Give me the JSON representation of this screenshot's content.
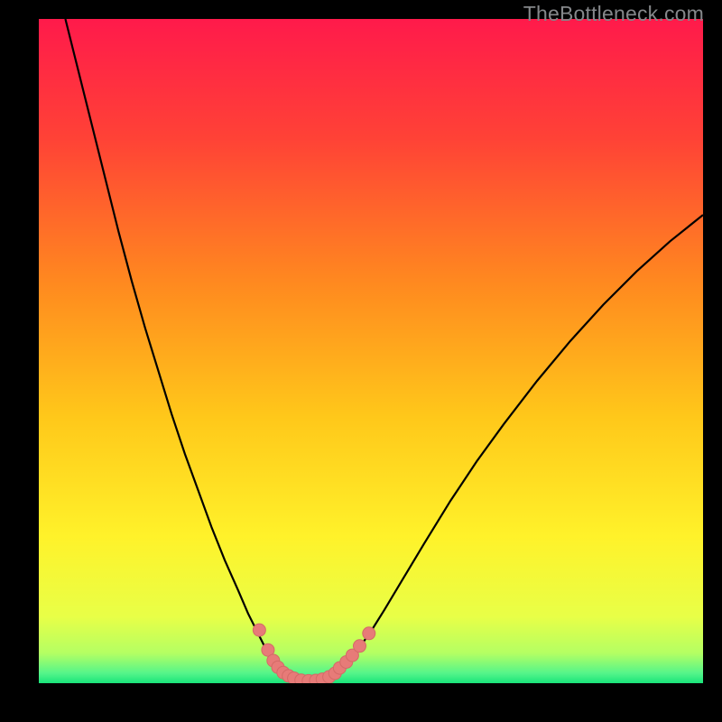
{
  "watermark": "TheBottleneck.com",
  "colors": {
    "gradient_stops": [
      {
        "offset": 0.0,
        "color": "#ff1a4b"
      },
      {
        "offset": 0.18,
        "color": "#ff4236"
      },
      {
        "offset": 0.4,
        "color": "#ff8a1f"
      },
      {
        "offset": 0.6,
        "color": "#ffc81a"
      },
      {
        "offset": 0.78,
        "color": "#fff22a"
      },
      {
        "offset": 0.9,
        "color": "#e8ff47"
      },
      {
        "offset": 0.955,
        "color": "#b4ff63"
      },
      {
        "offset": 0.985,
        "color": "#55f58a"
      },
      {
        "offset": 1.0,
        "color": "#19e47a"
      }
    ],
    "curve": "#000000",
    "marker_fill": "#e77b78",
    "marker_stroke": "#d46a67"
  },
  "chart_data": {
    "type": "line",
    "title": "",
    "xlabel": "",
    "ylabel": "",
    "xlim": [
      0,
      100
    ],
    "ylim": [
      0,
      100
    ],
    "curve_points": [
      {
        "x": 4.0,
        "y": 100.0
      },
      {
        "x": 6.0,
        "y": 92.0
      },
      {
        "x": 8.0,
        "y": 84.0
      },
      {
        "x": 10.0,
        "y": 76.0
      },
      {
        "x": 12.0,
        "y": 68.0
      },
      {
        "x": 14.0,
        "y": 60.5
      },
      {
        "x": 16.0,
        "y": 53.5
      },
      {
        "x": 18.0,
        "y": 47.0
      },
      {
        "x": 20.0,
        "y": 40.5
      },
      {
        "x": 22.0,
        "y": 34.5
      },
      {
        "x": 24.0,
        "y": 29.0
      },
      {
        "x": 26.0,
        "y": 23.5
      },
      {
        "x": 28.0,
        "y": 18.5
      },
      {
        "x": 30.0,
        "y": 14.0
      },
      {
        "x": 31.5,
        "y": 10.5
      },
      {
        "x": 33.0,
        "y": 7.5
      },
      {
        "x": 34.5,
        "y": 4.5
      },
      {
        "x": 36.0,
        "y": 2.5
      },
      {
        "x": 37.5,
        "y": 1.2
      },
      {
        "x": 39.0,
        "y": 0.5
      },
      {
        "x": 40.5,
        "y": 0.2
      },
      {
        "x": 42.0,
        "y": 0.3
      },
      {
        "x": 43.5,
        "y": 0.8
      },
      {
        "x": 45.0,
        "y": 1.9
      },
      {
        "x": 46.5,
        "y": 3.3
      },
      {
        "x": 48.0,
        "y": 5.0
      },
      {
        "x": 50.0,
        "y": 7.8
      },
      {
        "x": 52.0,
        "y": 11.0
      },
      {
        "x": 55.0,
        "y": 16.0
      },
      {
        "x": 58.0,
        "y": 21.0
      },
      {
        "x": 62.0,
        "y": 27.5
      },
      {
        "x": 66.0,
        "y": 33.5
      },
      {
        "x": 70.0,
        "y": 39.0
      },
      {
        "x": 75.0,
        "y": 45.5
      },
      {
        "x": 80.0,
        "y": 51.5
      },
      {
        "x": 85.0,
        "y": 57.0
      },
      {
        "x": 90.0,
        "y": 62.0
      },
      {
        "x": 95.0,
        "y": 66.5
      },
      {
        "x": 100.0,
        "y": 70.5
      }
    ],
    "markers": [
      {
        "x": 33.2,
        "y": 8.0
      },
      {
        "x": 34.5,
        "y": 5.0
      },
      {
        "x": 35.3,
        "y": 3.4
      },
      {
        "x": 36.0,
        "y": 2.4
      },
      {
        "x": 36.8,
        "y": 1.6
      },
      {
        "x": 37.6,
        "y": 1.1
      },
      {
        "x": 38.4,
        "y": 0.75
      },
      {
        "x": 39.5,
        "y": 0.45
      },
      {
        "x": 40.6,
        "y": 0.35
      },
      {
        "x": 41.7,
        "y": 0.4
      },
      {
        "x": 42.7,
        "y": 0.6
      },
      {
        "x": 43.7,
        "y": 0.95
      },
      {
        "x": 44.6,
        "y": 1.5
      },
      {
        "x": 45.3,
        "y": 2.3
      },
      {
        "x": 46.3,
        "y": 3.2
      },
      {
        "x": 47.2,
        "y": 4.2
      },
      {
        "x": 48.3,
        "y": 5.6
      },
      {
        "x": 49.7,
        "y": 7.5
      }
    ],
    "marker_radius_px": 7
  }
}
